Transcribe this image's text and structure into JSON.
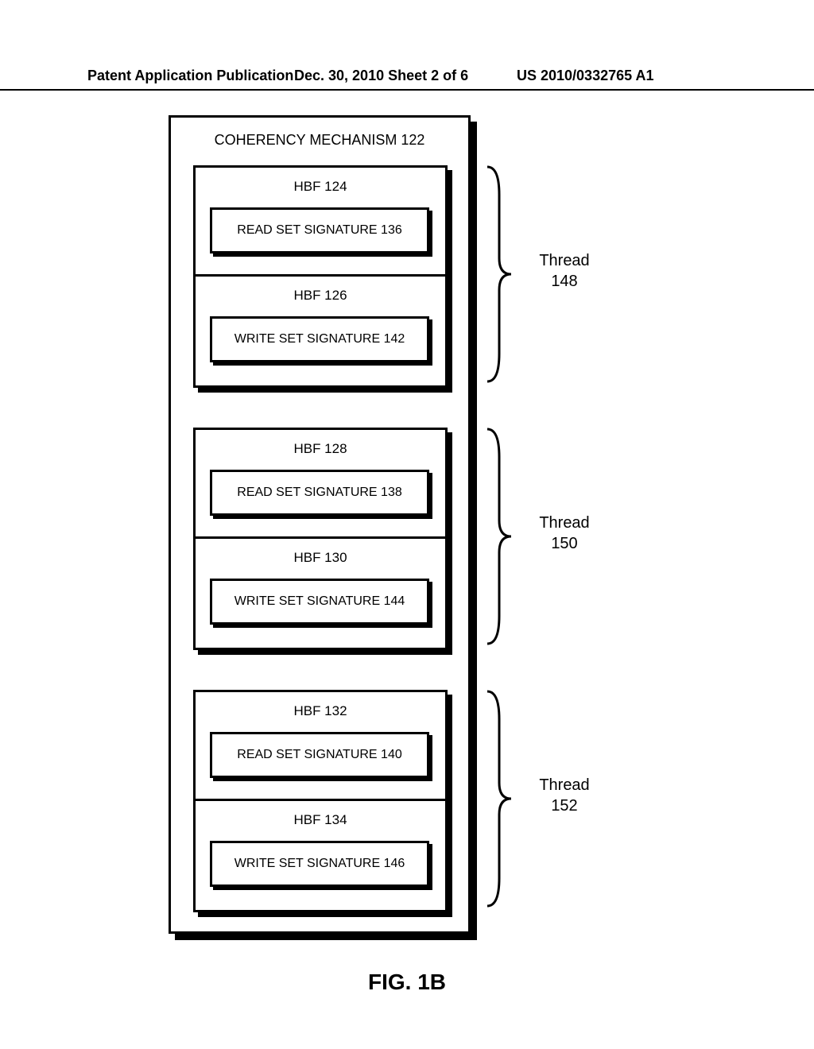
{
  "header": {
    "left": "Patent Application Publication",
    "center": "Dec. 30, 2010  Sheet 2 of 6",
    "right": "US 2010/0332765 A1"
  },
  "outer": {
    "title": "COHERENCY MECHANISM 122"
  },
  "groups": [
    {
      "hbf_read": "HBF 124",
      "sig_read": "READ SET SIGNATURE 136",
      "hbf_write": "HBF 126",
      "sig_write": "WRITE SET SIGNATURE 142",
      "thread_label": "Thread",
      "thread_num": "148"
    },
    {
      "hbf_read": "HBF 128",
      "sig_read": "READ SET SIGNATURE 138",
      "hbf_write": "HBF 130",
      "sig_write": "WRITE SET SIGNATURE 144",
      "thread_label": "Thread",
      "thread_num": "150"
    },
    {
      "hbf_read": "HBF 132",
      "sig_read": "READ SET SIGNATURE 140",
      "hbf_write": "HBF 134",
      "sig_write": "WRITE SET SIGNATURE 146",
      "thread_label": "Thread",
      "thread_num": "152"
    }
  ],
  "figure_label": "FIG. 1B"
}
